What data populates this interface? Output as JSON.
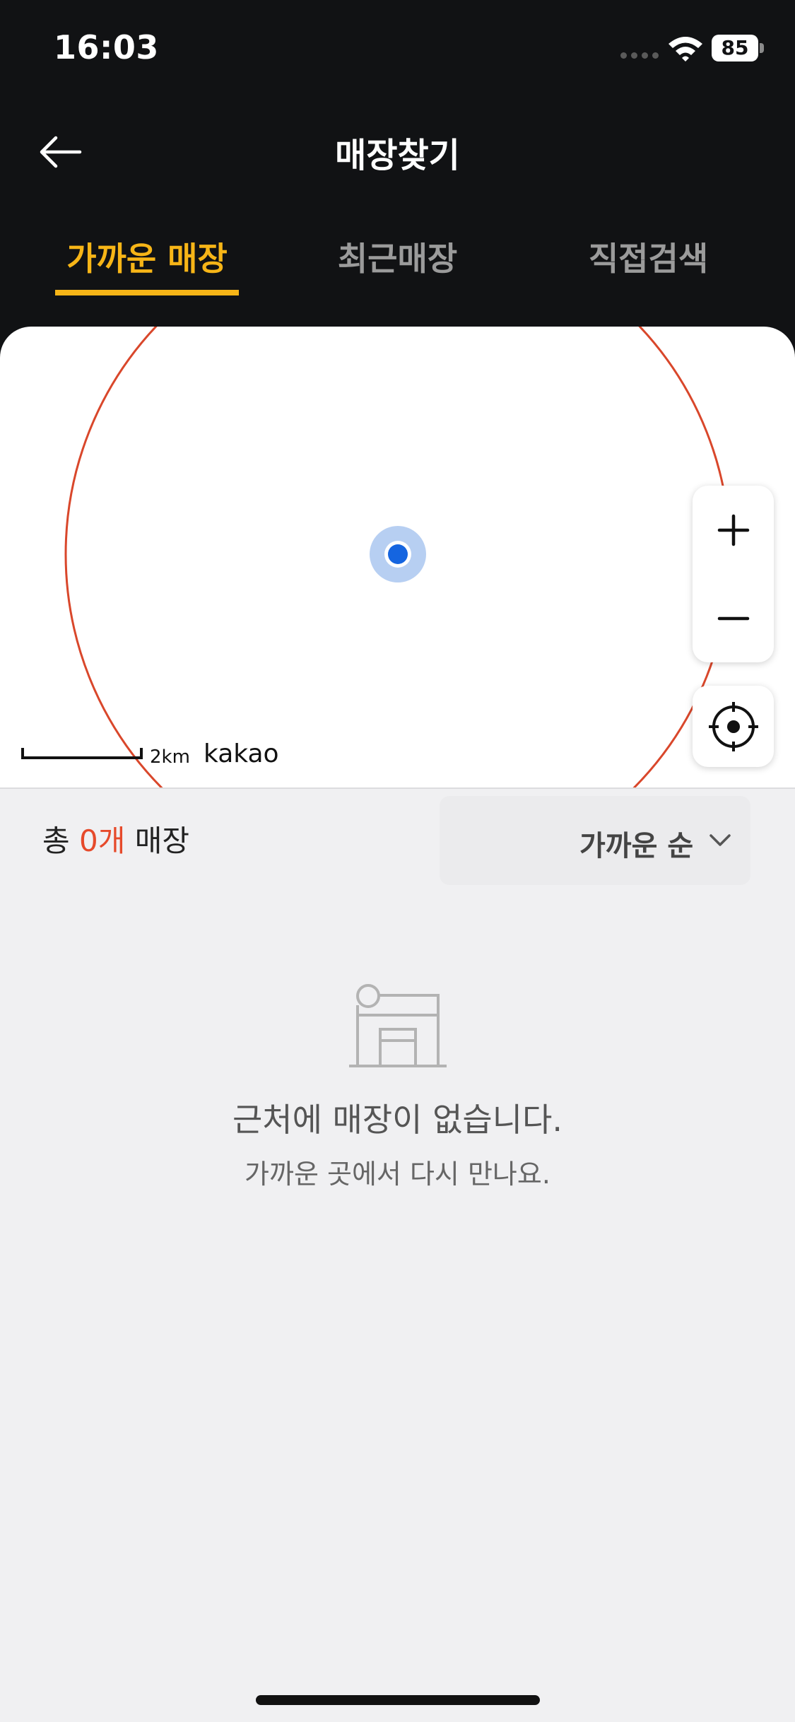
{
  "status_bar": {
    "time": "16:03",
    "battery": "85",
    "icons": [
      "signal-icon",
      "wifi-icon",
      "battery-icon"
    ]
  },
  "header": {
    "title": "매장찾기",
    "back_icon": "arrow-left-icon"
  },
  "tabs": [
    {
      "label": "가까운 매장",
      "active": true
    },
    {
      "label": "최근매장",
      "active": false
    },
    {
      "label": "직접검색",
      "active": false
    }
  ],
  "map": {
    "scale_label": "2km",
    "provider": "kakao",
    "controls": [
      "plus-icon",
      "minus-icon",
      "crosshair-icon"
    ]
  },
  "list": {
    "count_prefix": "총 ",
    "count_value": "0개",
    "count_suffix": " 매장",
    "sort_label": "가까운 순",
    "empty_icon": "store-icon",
    "empty_title": "근처에 매장이 없습니다.",
    "empty_subtitle": "가까운 곳에서 다시 만나요."
  },
  "colors": {
    "accent": "#f7b517",
    "count_highlight": "#e64a2b",
    "radius_circle": "#d9472b",
    "location_dot": "#1565e0",
    "background_dark": "#111214",
    "list_background": "#f0f0f2"
  }
}
